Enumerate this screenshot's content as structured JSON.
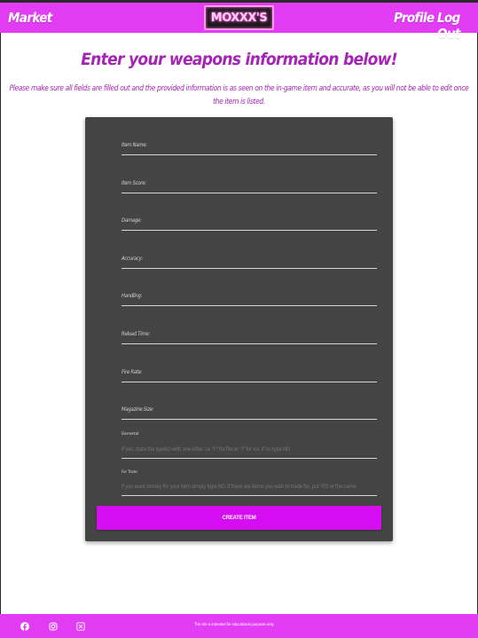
{
  "nav": {
    "market_label": "Market",
    "profile_label": "Profile",
    "logout_label": "Log Out",
    "logo_text": "MOXXX'S"
  },
  "page": {
    "title": "Enter your weapons information below!",
    "notice": "Please make sure all fields are filled out and the provided information is as seen on the in-game item and accurate, as you will not be able to edit once the item is listed."
  },
  "form": {
    "fields": [
      {
        "label": "Item Name:",
        "value": "",
        "placeholder": ""
      },
      {
        "label": "Item Score:",
        "value": "",
        "placeholder": ""
      },
      {
        "label": "Damage:",
        "value": "",
        "placeholder": ""
      },
      {
        "label": "Accuracy:",
        "value": "",
        "placeholder": ""
      },
      {
        "label": "Handling:",
        "value": "",
        "placeholder": ""
      },
      {
        "label": "Reload Time:",
        "value": "",
        "placeholder": ""
      },
      {
        "label": "Fire Rate:",
        "value": "",
        "placeholder": ""
      },
      {
        "label": "Magazine Size:",
        "value": "",
        "placeholder": ""
      },
      {
        "label": "Elemental:",
        "value": "",
        "placeholder": "If yes, state the type(s) with one letter. I.e \"F\" for fire or \"I\" for ice. If no type NO"
      },
      {
        "label": "For Trade:",
        "value": "",
        "placeholder": "If you want money for your item simply type NO. If there are items you wish to trade for, put YES or the name"
      }
    ],
    "submit_label": "CREATE ITEM"
  },
  "footer": {
    "disclaimer": "This site is intended for educational purposes only.",
    "icons": [
      "facebook-icon",
      "instagram-icon",
      "x-twitter-icon"
    ]
  },
  "colors": {
    "brand": "#e23cf4",
    "button": "#d60df2",
    "heading": "#a524b5",
    "card": "#444444"
  }
}
